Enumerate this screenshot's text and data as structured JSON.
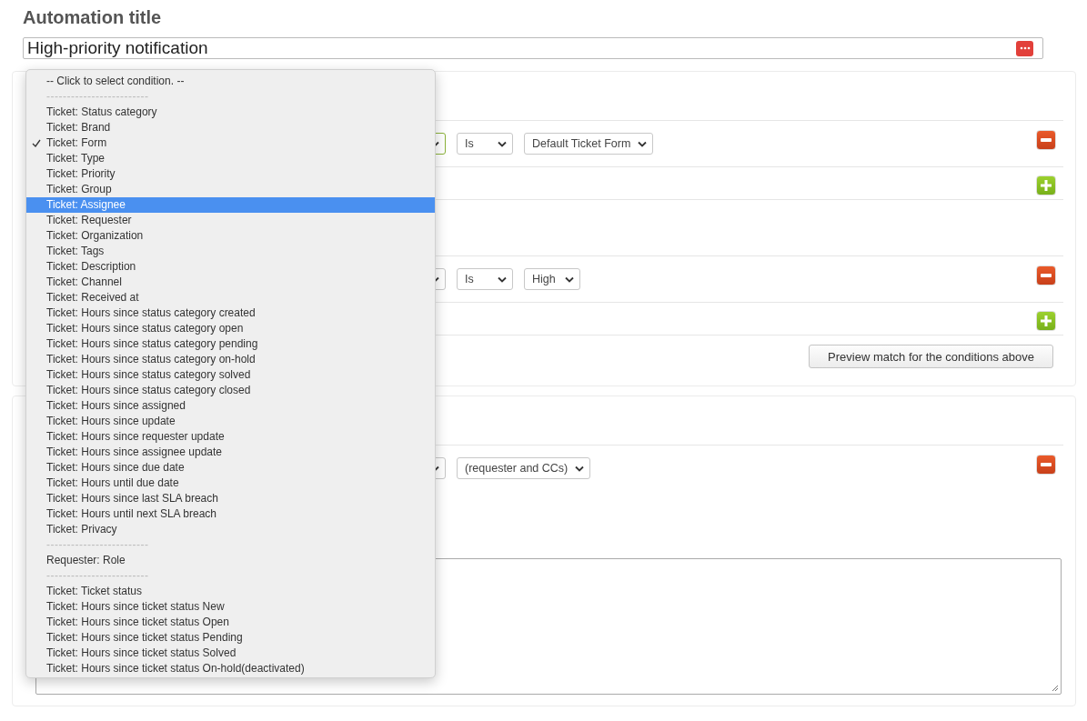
{
  "title_label": "Automation title",
  "title_input": {
    "value": "High-priority notification"
  },
  "sections": [
    {
      "kind": "conditions",
      "groups": [
        {
          "conditions": [
            {
              "field_focused": true,
              "operator": "Is",
              "value": "Default Ticket Form"
            }
          ]
        },
        {
          "conditions": [
            {
              "field_focused": false,
              "operator": "Is",
              "value": "High"
            }
          ]
        }
      ],
      "preview_button": "Preview match for the conditions above"
    },
    {
      "kind": "actions",
      "actions": [
        {
          "value": "(requester and CCs)"
        }
      ]
    }
  ],
  "dropdown": {
    "options": [
      {
        "kind": "option",
        "label": "-- Click to select condition. --",
        "checked": false,
        "selected": false
      },
      {
        "kind": "separator",
        "label": "-------------------------"
      },
      {
        "kind": "option",
        "label": "Ticket: Status category",
        "checked": false,
        "selected": false
      },
      {
        "kind": "option",
        "label": "Ticket: Brand",
        "checked": false,
        "selected": false
      },
      {
        "kind": "option",
        "label": "Ticket: Form",
        "checked": true,
        "selected": false
      },
      {
        "kind": "option",
        "label": "Ticket: Type",
        "checked": false,
        "selected": false
      },
      {
        "kind": "option",
        "label": "Ticket: Priority",
        "checked": false,
        "selected": false
      },
      {
        "kind": "option",
        "label": "Ticket: Group",
        "checked": false,
        "selected": false
      },
      {
        "kind": "option",
        "label": "Ticket: Assignee",
        "checked": false,
        "selected": true
      },
      {
        "kind": "option",
        "label": "Ticket: Requester",
        "checked": false,
        "selected": false
      },
      {
        "kind": "option",
        "label": "Ticket: Organization",
        "checked": false,
        "selected": false
      },
      {
        "kind": "option",
        "label": "Ticket: Tags",
        "checked": false,
        "selected": false
      },
      {
        "kind": "option",
        "label": "Ticket: Description",
        "checked": false,
        "selected": false
      },
      {
        "kind": "option",
        "label": "Ticket: Channel",
        "checked": false,
        "selected": false
      },
      {
        "kind": "option",
        "label": "Ticket: Received at",
        "checked": false,
        "selected": false
      },
      {
        "kind": "option",
        "label": "Ticket: Hours since status category created",
        "checked": false,
        "selected": false
      },
      {
        "kind": "option",
        "label": "Ticket: Hours since status category open",
        "checked": false,
        "selected": false
      },
      {
        "kind": "option",
        "label": "Ticket: Hours since status category pending",
        "checked": false,
        "selected": false
      },
      {
        "kind": "option",
        "label": "Ticket: Hours since status category on-hold",
        "checked": false,
        "selected": false
      },
      {
        "kind": "option",
        "label": "Ticket: Hours since status category solved",
        "checked": false,
        "selected": false
      },
      {
        "kind": "option",
        "label": "Ticket: Hours since status category closed",
        "checked": false,
        "selected": false
      },
      {
        "kind": "option",
        "label": "Ticket: Hours since assigned",
        "checked": false,
        "selected": false
      },
      {
        "kind": "option",
        "label": "Ticket: Hours since update",
        "checked": false,
        "selected": false
      },
      {
        "kind": "option",
        "label": "Ticket: Hours since requester update",
        "checked": false,
        "selected": false
      },
      {
        "kind": "option",
        "label": "Ticket: Hours since assignee update",
        "checked": false,
        "selected": false
      },
      {
        "kind": "option",
        "label": "Ticket: Hours since due date",
        "checked": false,
        "selected": false
      },
      {
        "kind": "option",
        "label": "Ticket: Hours until due date",
        "checked": false,
        "selected": false
      },
      {
        "kind": "option",
        "label": "Ticket: Hours since last SLA breach",
        "checked": false,
        "selected": false
      },
      {
        "kind": "option",
        "label": "Ticket: Hours until next SLA breach",
        "checked": false,
        "selected": false
      },
      {
        "kind": "option",
        "label": "Ticket: Privacy",
        "checked": false,
        "selected": false
      },
      {
        "kind": "separator",
        "label": "-------------------------"
      },
      {
        "kind": "option",
        "label": "Requester: Role",
        "checked": false,
        "selected": false
      },
      {
        "kind": "separator",
        "label": "-------------------------"
      },
      {
        "kind": "option",
        "label": "Ticket: Ticket status",
        "checked": false,
        "selected": false
      },
      {
        "kind": "option",
        "label": "Ticket: Hours since ticket status New",
        "checked": false,
        "selected": false
      },
      {
        "kind": "option",
        "label": "Ticket: Hours since ticket status Open",
        "checked": false,
        "selected": false
      },
      {
        "kind": "option",
        "label": "Ticket: Hours since ticket status Pending",
        "checked": false,
        "selected": false
      },
      {
        "kind": "option",
        "label": "Ticket: Hours since ticket status Solved",
        "checked": false,
        "selected": false
      },
      {
        "kind": "option",
        "label": "Ticket: Hours since ticket status On-hold(deactivated)",
        "checked": false,
        "selected": false
      }
    ]
  }
}
